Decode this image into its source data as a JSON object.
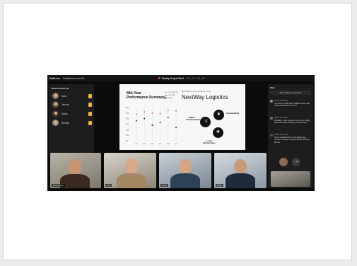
{
  "topbar": {
    "app_label": "MultiLane",
    "room": "Conference room 1/3",
    "meeting": "Weekly Project Brief",
    "time_elapsed": "1:20 | 20",
    "time_total": "1:50 | 25"
  },
  "raised_hands": {
    "title": "Raised hands (4)",
    "items": [
      {
        "name": "Nola"
      },
      {
        "name": "Jehoba"
      },
      {
        "name": "Adora"
      },
      {
        "name": "Renmie"
      }
    ]
  },
  "slide": {
    "title_line1": "Mid-Year",
    "title_line2": "Performance Summary",
    "legend": [
      "Cost Results",
      "Actual $k",
      "Target"
    ],
    "company_tag": "Mid-Year",
    "company_tag_rest": "Bring Expectations Closer",
    "company": "NextWay Logistics",
    "diagram_labels": [
      "Digital Transformation",
      "Sustainability",
      "Local Partnerships"
    ]
  },
  "chart_data": {
    "type": "scatter",
    "categories": [
      "Jan",
      "Feb",
      "Mar",
      "Apr",
      "May",
      "Jun"
    ],
    "yticks": [
      "$60",
      "$50",
      "$40",
      "$30",
      "$20",
      "$10",
      "$0"
    ],
    "series": [
      {
        "name": "Cost Results",
        "values": [
          48,
          52,
          50,
          49,
          55,
          54
        ]
      },
      {
        "name": "Actual $k",
        "values": [
          36,
          40,
          28,
          33,
          42,
          24
        ]
      }
    ],
    "ylim": [
      0,
      60
    ],
    "colors": {
      "Cost Results": "#e24a4a",
      "Actual $k": "#111111"
    }
  },
  "chat": {
    "title": "Chat",
    "first": "about influencer partner?",
    "messages": [
      {
        "author": "Rahul 10:20 AM",
        "text": "You are so confirmed, initiatives done with these influencers in our list."
      },
      {
        "author": "Javier 10:20 AM",
        "text": "Fantastic. Let's move on to our next. Okay, what's the blog strategy coming along?"
      },
      {
        "author": "Adora 10:21 AM",
        "text": "We've published four new articles this month, focusing on keywords identified by Emma."
      }
    ]
  },
  "video_tiles": [
    {
      "name": "Adora Morris"
    },
    {
      "name": "Lina"
    },
    {
      "name": "Javier"
    },
    {
      "name": "Rahul"
    }
  ],
  "icons": {
    "raise_hand": "hand-icon",
    "send": "send-icon"
  }
}
